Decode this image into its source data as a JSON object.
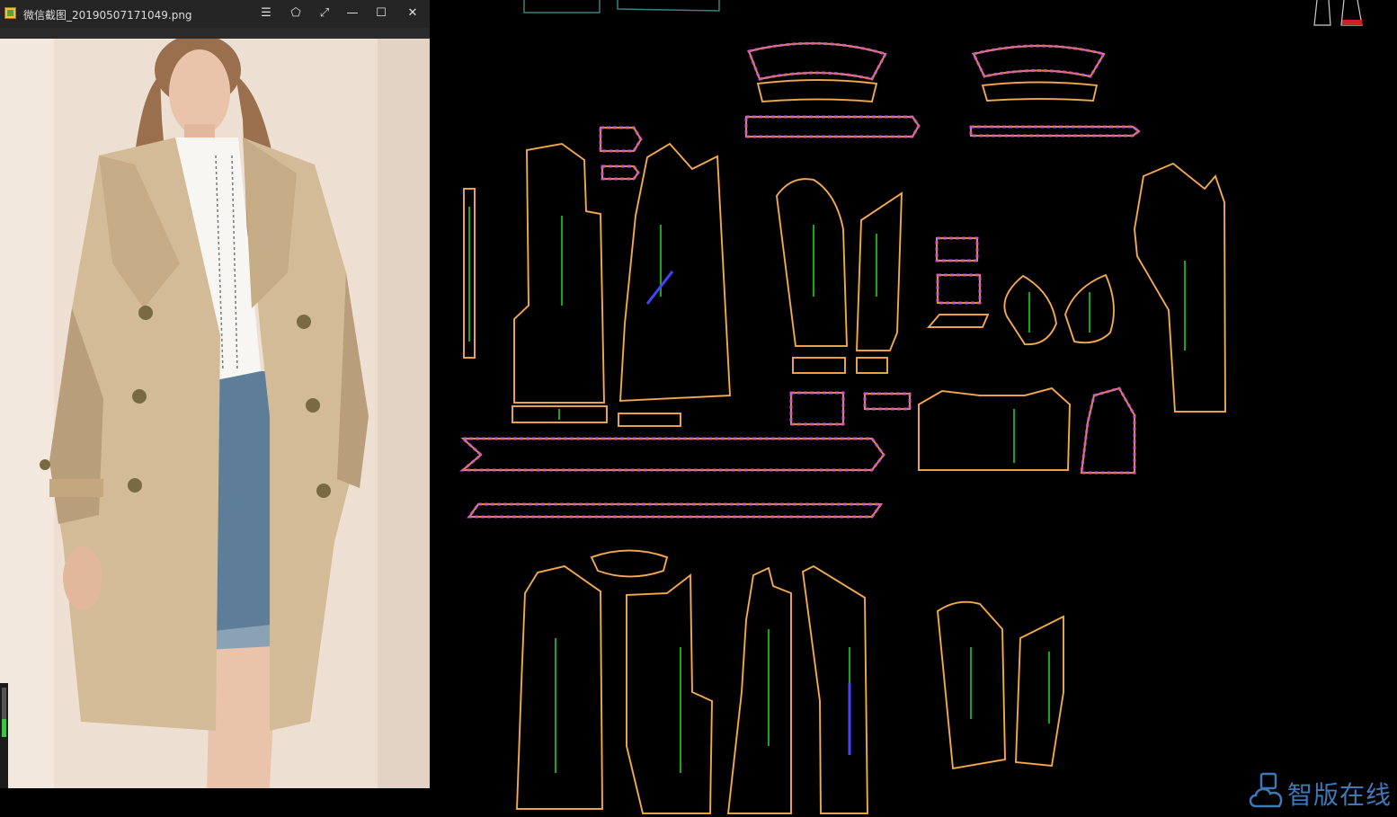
{
  "window": {
    "title": "微信截图_20190507171049.png",
    "buttons": [
      {
        "name": "menu-button",
        "glyph": "☰"
      },
      {
        "name": "pin-button",
        "glyph": "⬠"
      },
      {
        "name": "fullscreen-button",
        "glyph": "⤢"
      },
      {
        "name": "minimize-button",
        "glyph": "—"
      },
      {
        "name": "maximize-button",
        "glyph": "☐"
      },
      {
        "name": "close-button",
        "glyph": "✕"
      }
    ]
  },
  "photo": {
    "subject": "model-in-trench-coat",
    "colors": {
      "background": "#ede0d3",
      "coat": "#d4bb98",
      "coat_shadow": "#b89e7a",
      "shirt": "#f7f6f2",
      "denim": "#5d7d98",
      "skin": "#e9c4aa",
      "hair": "#9a6f4d",
      "button": "#7a6a44"
    }
  },
  "cad": {
    "background": "#000000",
    "colors": {
      "outline": "#e6922f",
      "inner": "#f2d5a0",
      "grain": "#22dd22",
      "hatch": "#d055d0",
      "accent_blue": "#4444ff",
      "label": "#ffffff"
    },
    "pieces": [
      "collar-top",
      "collar-stand",
      "front-panel",
      "back-panel",
      "sleeve",
      "pocket-flap",
      "belt",
      "yoke",
      "lining-panel"
    ]
  },
  "watermark": {
    "text": "智版在线",
    "color": "#3f78b7",
    "icon": "cloud-icon"
  }
}
